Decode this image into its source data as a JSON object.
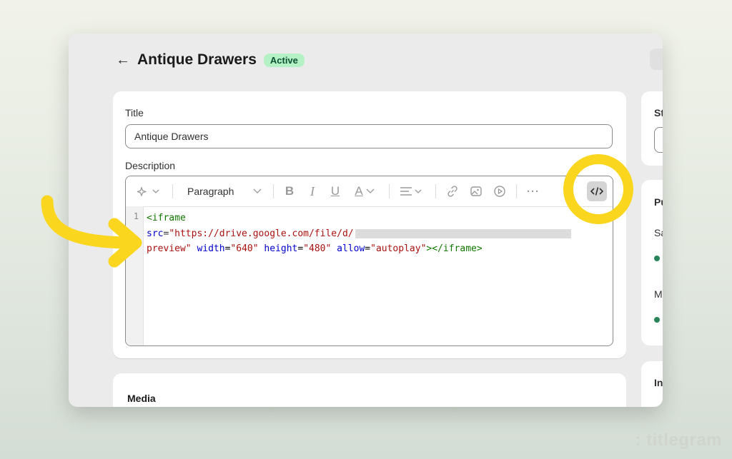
{
  "header": {
    "back_icon": "arrow-left-icon",
    "title": "Antique Drawers",
    "status": "Active"
  },
  "form": {
    "title_label": "Title",
    "title_value": "Antique Drawers",
    "description_label": "Description"
  },
  "toolbar": {
    "magic": "sparkle-icon",
    "paragraph_label": "Paragraph",
    "bold": "B",
    "italic": "I",
    "underline": "U",
    "text_color": "A",
    "more": "···",
    "code_icon": "</>"
  },
  "code": {
    "line_number": "1",
    "line1_tag": "<iframe",
    "line2_attr": "src",
    "line2_eq": "=",
    "line2_str": "\"https://drive.google.com/file/d/",
    "line3_str1": "preview\"",
    "line3_attr1": "width",
    "line3_str2": "\"640\"",
    "line3_attr2": "height",
    "line3_str3": "\"480\"",
    "line3_attr3": "allow",
    "line3_str4": "\"autoplay\"",
    "line3_close": "></iframe>"
  },
  "media": {
    "label": "Media"
  },
  "sidebar": {
    "card1_label": "St",
    "card2_label": "Pu",
    "card2_item1": "Sa",
    "card2_item2": "M",
    "card3_label": "In"
  },
  "annotation_colors": {
    "highlight": "#fbd61e",
    "status_badge": "#b4f2c6"
  },
  "watermark": ": titlegram"
}
